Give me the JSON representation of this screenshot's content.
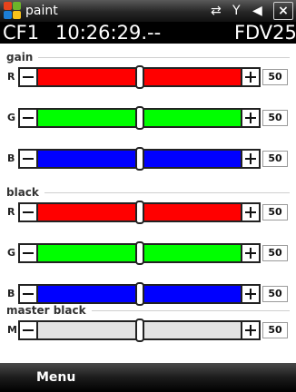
{
  "titlebar": {
    "app_title": "paint",
    "status_icons": [
      "network-icon",
      "signal-icon",
      "volume-icon"
    ],
    "close_label": "×"
  },
  "status": {
    "card": "CF1",
    "time": "10:26:29.--",
    "flag": "F",
    "device": "DV25"
  },
  "sections": [
    {
      "title": "gain",
      "rows": [
        {
          "channel": "R",
          "value": "50",
          "level": 0.5,
          "color": "#ff0000"
        },
        {
          "channel": "G",
          "value": "50",
          "level": 0.5,
          "color": "#00ff00"
        },
        {
          "channel": "B",
          "value": "50",
          "level": 0.5,
          "color": "#0000ff"
        }
      ]
    },
    {
      "title": "black",
      "rows": [
        {
          "channel": "R",
          "value": "50",
          "level": 0.5,
          "color": "#ff0000"
        },
        {
          "channel": "G",
          "value": "50",
          "level": 0.5,
          "color": "#00ff00"
        },
        {
          "channel": "B",
          "value": "50",
          "level": 0.5,
          "color": "#0000ff"
        }
      ]
    },
    {
      "title": "master black",
      "rows": [
        {
          "channel": "M",
          "value": "50",
          "level": 0.5,
          "color": "#e3e3e3"
        }
      ]
    }
  ],
  "menubar": {
    "menu_label": "Menu"
  },
  "colors": {
    "slider_rest": "#e6e6e6",
    "titlebar": "#262626"
  }
}
